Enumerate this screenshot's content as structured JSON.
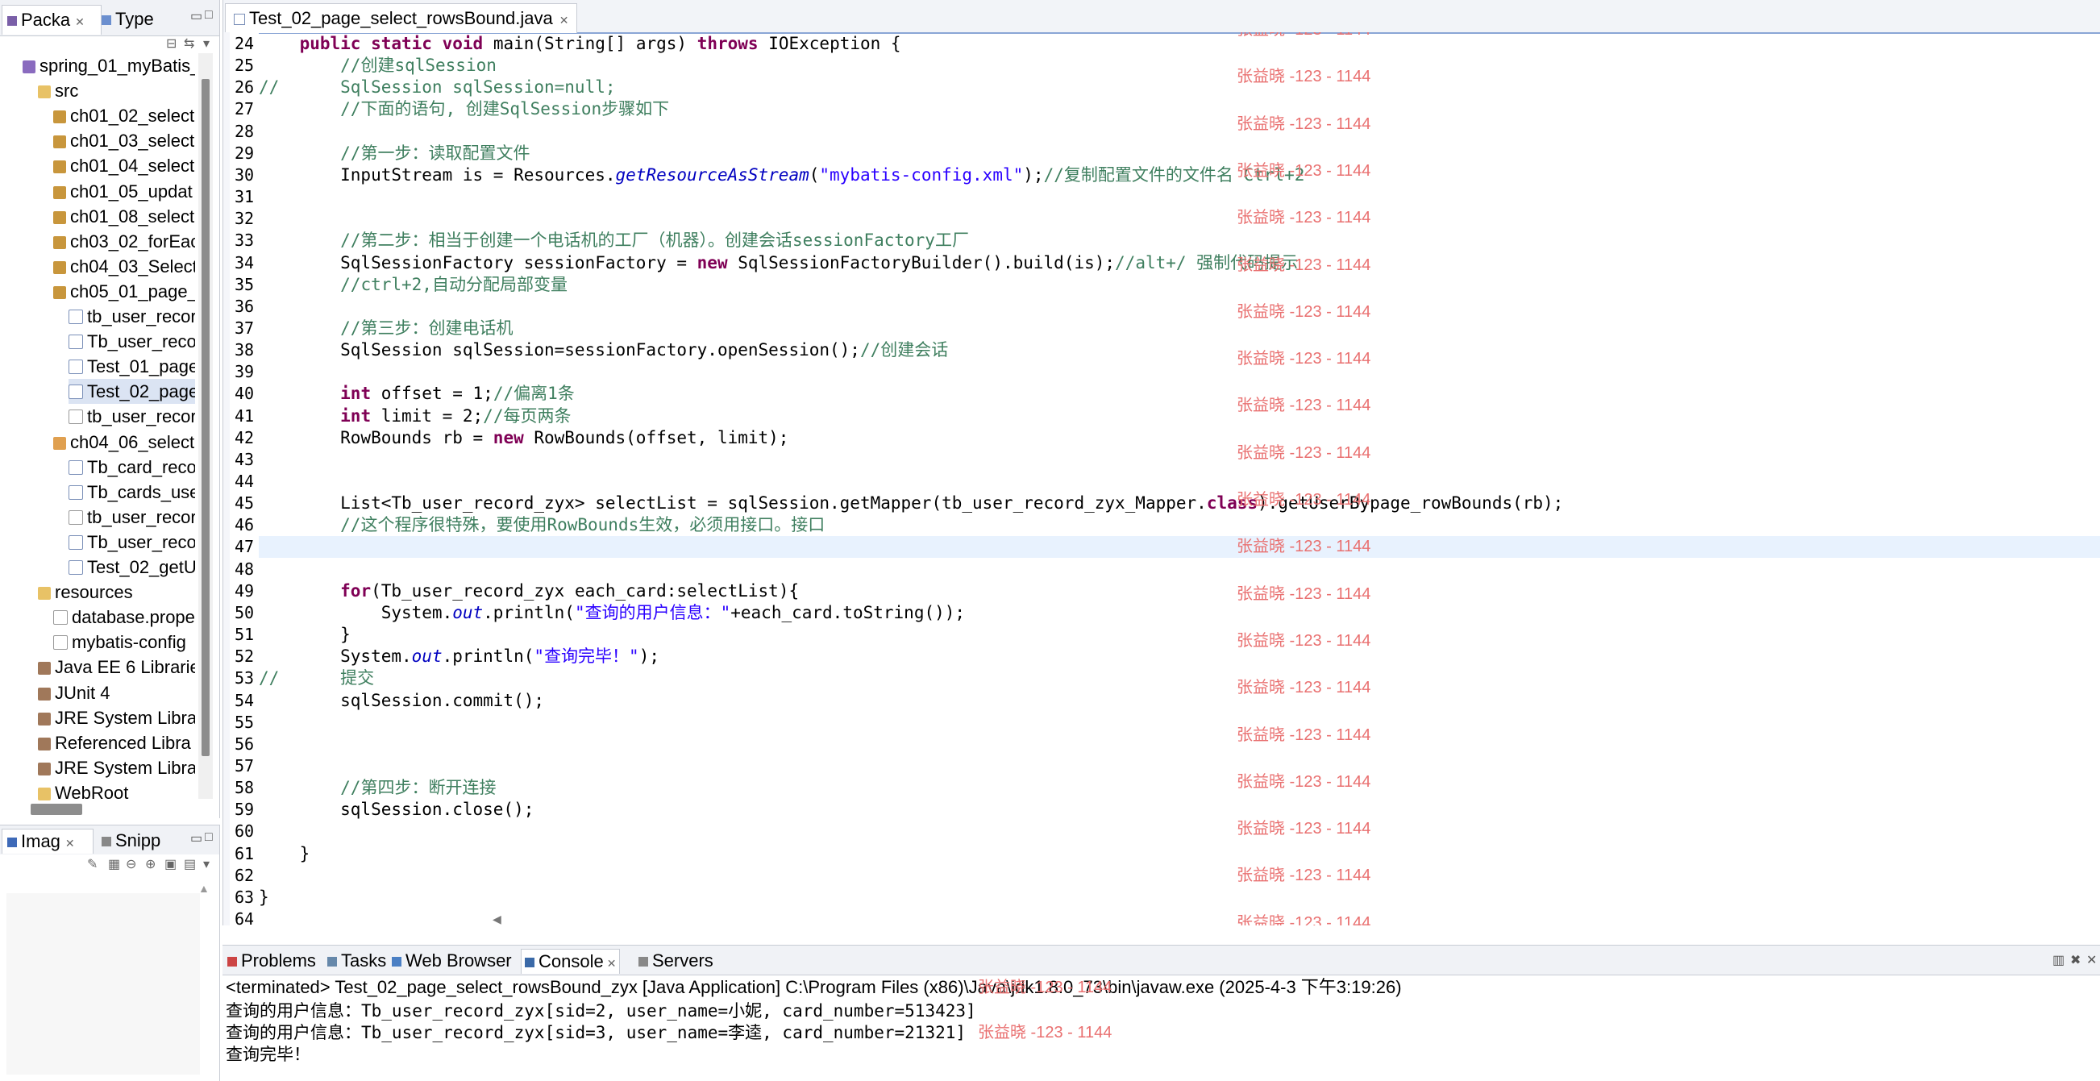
{
  "left_panel": {
    "tabs": [
      {
        "label": "Packa"
      },
      {
        "label": "Type"
      }
    ],
    "tree": [
      {
        "label": "spring_01_myBatis_",
        "icon": "project-icon",
        "depth": 0
      },
      {
        "label": "src",
        "icon": "source-folder-icon",
        "depth": 1
      },
      {
        "label": "ch01_02_select",
        "icon": "package-icon",
        "depth": 2
      },
      {
        "label": "ch01_03_select",
        "icon": "package-icon",
        "depth": 2
      },
      {
        "label": "ch01_04_select",
        "icon": "package-icon",
        "depth": 2
      },
      {
        "label": "ch01_05_updat",
        "icon": "package-icon",
        "depth": 2
      },
      {
        "label": "ch01_08_select",
        "icon": "package-icon",
        "depth": 2
      },
      {
        "label": "ch03_02_forEac",
        "icon": "package-icon",
        "depth": 2
      },
      {
        "label": "ch04_03_Select",
        "icon": "package-icon",
        "depth": 2
      },
      {
        "label": "ch05_01_page_",
        "icon": "package-icon",
        "depth": 2
      },
      {
        "label": "tb_user_recor",
        "icon": "java-file-icon",
        "depth": 3
      },
      {
        "label": "Tb_user_reco",
        "icon": "java-file-icon",
        "depth": 3
      },
      {
        "label": "Test_01_page",
        "icon": "java-file-icon",
        "depth": 3
      },
      {
        "label": "Test_02_page",
        "icon": "java-file-icon",
        "depth": 3,
        "selected": true
      },
      {
        "label": "tb_user_recor",
        "icon": "xml-file-icon",
        "depth": 3
      },
      {
        "label": "ch04_06_select",
        "icon": "package-open-icon",
        "depth": 2
      },
      {
        "label": "Tb_card_reco",
        "icon": "java-file-icon",
        "depth": 3
      },
      {
        "label": "Tb_cards_use",
        "icon": "java-file-icon",
        "depth": 3
      },
      {
        "label": "tb_user_recor",
        "icon": "xml-file-icon",
        "depth": 3
      },
      {
        "label": "Tb_user_reco",
        "icon": "java-file-icon",
        "depth": 3
      },
      {
        "label": "Test_02_getU",
        "icon": "java-file-icon",
        "depth": 3
      },
      {
        "label": "resources",
        "icon": "source-folder-icon",
        "depth": 1
      },
      {
        "label": "database.prope",
        "icon": "properties-file-icon",
        "depth": 2
      },
      {
        "label": "mybatis-config",
        "icon": "xml-file-icon",
        "depth": 2
      },
      {
        "label": "Java EE 6 Librarie",
        "icon": "library-icon",
        "depth": 1
      },
      {
        "label": "JUnit 4",
        "icon": "library-icon",
        "depth": 1
      },
      {
        "label": "JRE System Libra",
        "icon": "library-icon",
        "depth": 1
      },
      {
        "label": "Referenced Libra",
        "icon": "library-icon",
        "depth": 1
      },
      {
        "label": "JRE System Libra",
        "icon": "library-icon",
        "depth": 1
      },
      {
        "label": "WebRoot",
        "icon": "folder-icon",
        "depth": 1
      }
    ]
  },
  "left_bottom": {
    "tabs": [
      {
        "label": "Imag"
      },
      {
        "label": "Snipp"
      }
    ]
  },
  "editor": {
    "tab_label": "Test_02_page_select_rowsBound.java",
    "watermark": "张益晓 -123 - 1144",
    "lines": [
      {
        "num": "24",
        "html": "    <span class=\"kw\">public</span> <span class=\"kw\">static</span> <span class=\"kw\">void</span> main(String[] args) <span class=\"kw\">throws</span> IOException {"
      },
      {
        "num": "25",
        "html": "        <span class=\"cm\">//创建sqlSession</span>"
      },
      {
        "num": "26",
        "html": "<span class=\"cm\">//      SqlSession sqlSession=null;</span>"
      },
      {
        "num": "27",
        "html": "        <span class=\"cm\">//下面的语句, 创建SqlSession步骤如下</span>"
      },
      {
        "num": "28",
        "html": ""
      },
      {
        "num": "29",
        "html": "        <span class=\"cm\">//第一步：读取配置文件</span>"
      },
      {
        "num": "30",
        "html": "        InputStream is = Resources.<span class=\"st\">getResourceAsStream</span>(<span class=\"str\">\"mybatis-config.xml\"</span>);<span class=\"cm\">//复制配置文件的文件名 Ctrl+2</span>"
      },
      {
        "num": "31",
        "html": ""
      },
      {
        "num": "32",
        "html": ""
      },
      {
        "num": "33",
        "html": "        <span class=\"cm\">//第二步：相当于创建一个电话机的工厂（机器）。创建会话sessionFactory工厂</span>"
      },
      {
        "num": "34",
        "html": "        SqlSessionFactory sessionFactory = <span class=\"kw\">new</span> SqlSessionFactoryBuilder().build(is);<span class=\"cm\">//alt+/ 强制代码提示</span>"
      },
      {
        "num": "35",
        "html": "        <span class=\"cm\">//ctrl+2,自动分配局部变量</span>"
      },
      {
        "num": "36",
        "html": ""
      },
      {
        "num": "37",
        "html": "        <span class=\"cm\">//第三步：创建电话机</span>"
      },
      {
        "num": "38",
        "html": "        SqlSession sqlSession=sessionFactory.openSession();<span class=\"cm\">//创建会话</span>"
      },
      {
        "num": "39",
        "html": ""
      },
      {
        "num": "40",
        "html": "        <span class=\"kw\">int</span> offset = 1;<span class=\"cm\">//偏离1条</span>"
      },
      {
        "num": "41",
        "html": "        <span class=\"kw\">int</span> limit = 2;<span class=\"cm\">//每页两条</span>"
      },
      {
        "num": "42",
        "html": "        RowBounds rb = <span class=\"kw\">new</span> RowBounds(offset, limit);"
      },
      {
        "num": "43",
        "html": ""
      },
      {
        "num": "44",
        "html": ""
      },
      {
        "num": "45",
        "html": "        List&lt;Tb_user_record_zyx&gt; selectList = sqlSession.getMapper(tb_user_record_zyx_Mapper.<span class=\"kw\">class</span>).getUserBypage_rowBounds(rb);"
      },
      {
        "num": "46",
        "html": "        <span class=\"cm\">//这个程序很特殊，要使用RowBounds生效，必须用接口。接口</span>"
      },
      {
        "num": "47",
        "html": "",
        "current": true
      },
      {
        "num": "48",
        "html": ""
      },
      {
        "num": "49",
        "html": "        <span class=\"kw\">for</span>(Tb_user_record_zyx each_card:selectList){"
      },
      {
        "num": "50",
        "html": "            System.<span class=\"fld\">out</span>.println(<span class=\"str\">\"查询的用户信息：\"</span>+each_card.toString());"
      },
      {
        "num": "51",
        "html": "        }"
      },
      {
        "num": "52",
        "html": "        System.<span class=\"fld\">out</span>.println(<span class=\"str\">\"查询完毕！\"</span>);"
      },
      {
        "num": "53",
        "html": "<span class=\"cm\">//      提交</span>"
      },
      {
        "num": "54",
        "html": "        sqlSession.commit();"
      },
      {
        "num": "55",
        "html": ""
      },
      {
        "num": "56",
        "html": ""
      },
      {
        "num": "57",
        "html": ""
      },
      {
        "num": "58",
        "html": "        <span class=\"cm\">//第四步：断开连接</span>"
      },
      {
        "num": "59",
        "html": "        sqlSession.close();"
      },
      {
        "num": "60",
        "html": ""
      },
      {
        "num": "61",
        "html": "    }"
      },
      {
        "num": "62",
        "html": ""
      },
      {
        "num": "63",
        "html": "}"
      },
      {
        "num": "64",
        "html": ""
      }
    ]
  },
  "bottom": {
    "tabs": [
      {
        "label": "Problems"
      },
      {
        "label": "Tasks"
      },
      {
        "label": "Web Browser"
      },
      {
        "label": "Console",
        "active": true
      },
      {
        "label": "Servers"
      }
    ],
    "status": "<terminated> Test_02_page_select_rowsBound_zyx [Java Application] C:\\Program Files (x86)\\Java\\jdk1.8.0_73\\bin\\javaw.exe (2025-4-3 下午3:19:26)",
    "output": [
      "查询的用户信息：Tb_user_record_zyx[sid=2, user_name=小妮, card_number=513423]",
      "查询的用户信息：Tb_user_record_zyx[sid=3, user_name=李逵, card_number=21321]",
      "查询完毕！"
    ],
    "watermark": "张益晓 -123 - 1144"
  }
}
